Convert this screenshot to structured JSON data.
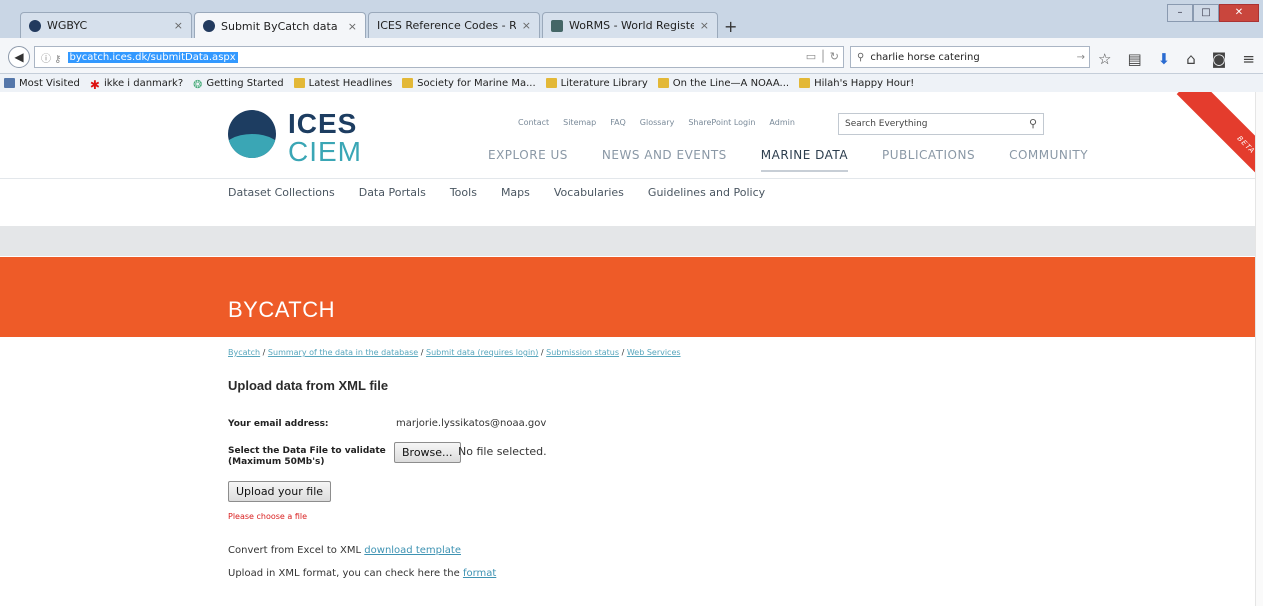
{
  "browser": {
    "tabs": [
      {
        "label": "WGBYC",
        "icon": "ices-icon"
      },
      {
        "label": "Submit ByCatch data",
        "icon": "ices-icon",
        "active": true
      },
      {
        "label": "ICES Reference Codes - RECO",
        "icon": "none"
      },
      {
        "label": "WoRMS - World Register o...",
        "icon": "worms-icon"
      }
    ],
    "new_tab": "+",
    "url": "bycatch.ices.dk/submitData.aspx",
    "search_value": "charlie horse catering",
    "bookmarks": [
      "Most Visited",
      "ikke i danmark?",
      "Getting Started",
      "Latest Headlines",
      "Society for Marine Ma...",
      "Literature Library",
      "On the Line—A NOAA...",
      "Hilah's Happy Hour!"
    ]
  },
  "site": {
    "logo": {
      "line1": "ICES",
      "line2": "CIEM"
    },
    "utility_links": [
      "Contact",
      "Sitemap",
      "FAQ",
      "Glossary",
      "SharePoint Login",
      "Admin"
    ],
    "search_placeholder": "Search Everything",
    "main_nav": [
      "EXPLORE US",
      "NEWS AND EVENTS",
      "MARINE DATA",
      "PUBLICATIONS",
      "COMMUNITY"
    ],
    "active_nav": "MARINE DATA",
    "sub_nav": [
      "Dataset Collections",
      "Data Portals",
      "Tools",
      "Maps",
      "Vocabularies",
      "Guidelines and Policy"
    ],
    "ribbon": "BETA",
    "banner_title": "BYCATCH",
    "breadcrumb": [
      "Bycatch",
      "Summary of the data in the database",
      "Submit data (requires login)",
      "Submission status",
      "Web Services"
    ],
    "breadcrumb_sep": " / "
  },
  "form": {
    "heading": "Upload data from XML file",
    "email_label": "Your email address:",
    "email_value": "marjorie.lyssikatos@noaa.gov",
    "file_label_1": "Select the Data File to validate",
    "file_label_2": "(Maximum 50Mb's)",
    "browse_button": "Browse...",
    "no_file_text": "No file selected.",
    "upload_button": "Upload your file",
    "error_text": "Please choose a file",
    "convert_text": "Convert from Excel to XML",
    "convert_link": "download template",
    "upload_text": "Upload in XML format, you can check here the",
    "format_link": "format"
  },
  "colors": {
    "banner": "#ee5b28",
    "ribbon": "#e43c2d",
    "link": "#58a6bd",
    "error": "#d92020"
  }
}
